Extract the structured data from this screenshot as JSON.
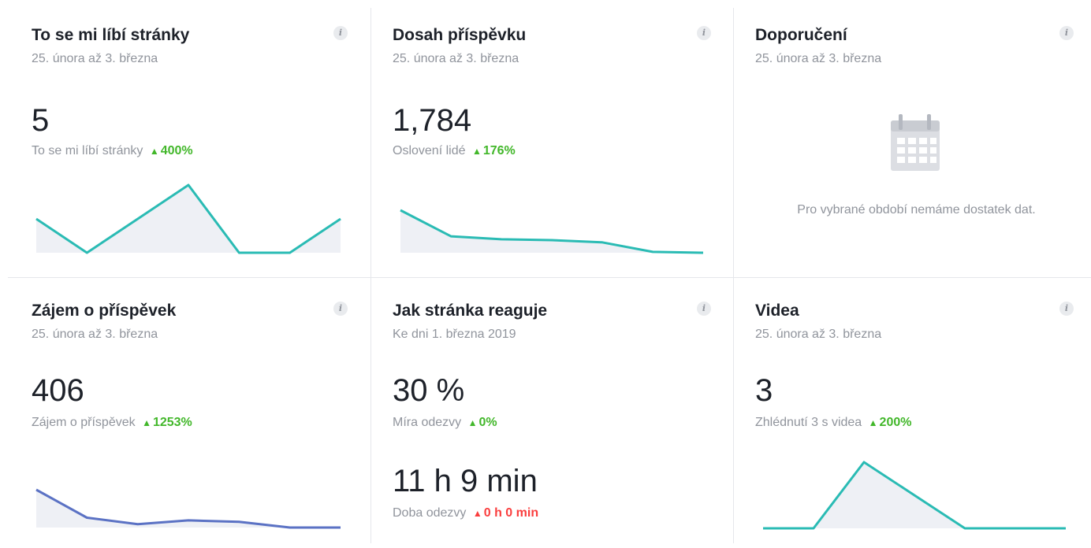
{
  "colors": {
    "teal": "#2abbb4",
    "blue": "#5b72c4",
    "up": "#42b72a",
    "down": "#fa3e3e",
    "fill": "#eef0f5"
  },
  "cards": {
    "page_likes": {
      "title": "To se mi líbí stránky",
      "subtitle": "25. února až 3. března",
      "value": "5",
      "metric_label": "To se mi líbí stránky",
      "delta_arrow": "▲",
      "delta": "400%",
      "sparkline": [
        1,
        0,
        1,
        2,
        0,
        0,
        1
      ]
    },
    "post_reach": {
      "title": "Dosah příspěvku",
      "subtitle": "25. února až 3. března",
      "value": "1,784",
      "metric_label": "Oslovení lidé",
      "delta_arrow": "▲",
      "delta": "176%",
      "sparkline": [
        10,
        4,
        3.3,
        3.1,
        2.6,
        0.4,
        0.2
      ]
    },
    "recommendations": {
      "title": "Doporučení",
      "subtitle": "25. února až 3. března",
      "icon": "calendar-icon",
      "empty_message": "Pro vybrané období nemáme dostatek dat."
    },
    "post_engagement": {
      "title": "Zájem o příspěvek",
      "subtitle": "25. února až 3. března",
      "value": "406",
      "metric_label": "Zájem o příspěvek",
      "delta_arrow": "▲",
      "delta": "1253%",
      "sparkline": [
        10,
        2.6,
        0.9,
        1.9,
        1.5,
        0,
        0
      ]
    },
    "responsiveness": {
      "title": "Jak stránka reaguje",
      "subtitle": "Ke dni 1. března 2019",
      "value": "30 %",
      "metric_label": "Míra odezvy",
      "delta_arrow": "▲",
      "delta": "0%",
      "value2": "11 h 9 min",
      "metric2_label": "Doba odezvy",
      "delta2_arrow": "▲",
      "delta2": "0 h 0 min"
    },
    "videos": {
      "title": "Videa",
      "subtitle": "25. února až 3. března",
      "value": "3",
      "metric_label": "Zhlédnutí 3 s videa",
      "delta_arrow": "▲",
      "delta": "200%",
      "sparkline": [
        0,
        0,
        3,
        1.5,
        0,
        0,
        0
      ]
    }
  }
}
